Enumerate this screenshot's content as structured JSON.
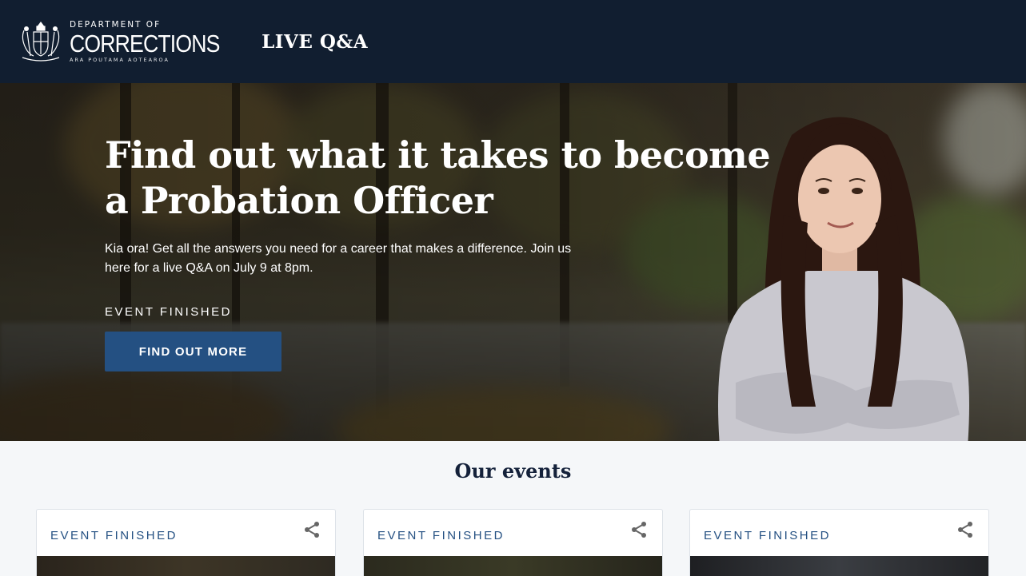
{
  "header": {
    "logo": {
      "line1": "DEPARTMENT OF",
      "line2": "CORRECTIONS",
      "line3": "ARA POUTAMA AOTEAROA"
    },
    "site_title": "LIVE Q&A"
  },
  "hero": {
    "title": "Find out what it takes to become a Probation Officer",
    "description": "Kia ora! Get all the answers you need for a career that makes a difference. Join us here for a live Q&A on July 9 at 8pm.",
    "status": "EVENT FINISHED",
    "cta_label": "FIND OUT MORE"
  },
  "events": {
    "title": "Our events",
    "cards": [
      {
        "status": "EVENT FINISHED"
      },
      {
        "status": "EVENT FINISHED"
      },
      {
        "status": "EVENT FINISHED"
      }
    ]
  },
  "colors": {
    "header_bg": "#111e30",
    "accent": "#245082",
    "heading": "#14213a"
  }
}
